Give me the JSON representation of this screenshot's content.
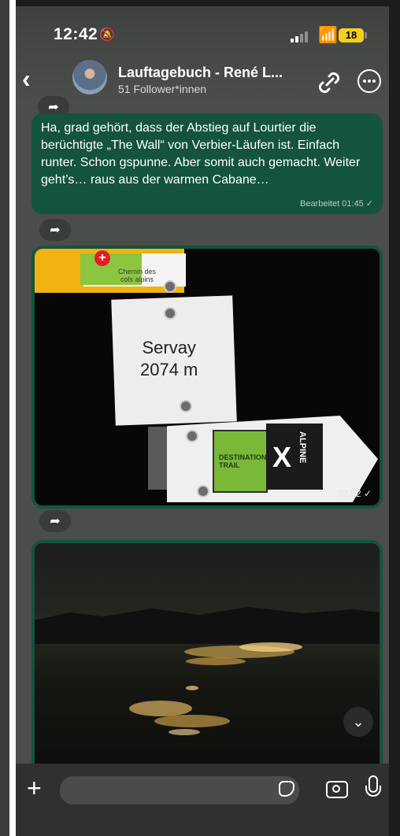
{
  "status_bar": {
    "time": "12:42",
    "battery": "18"
  },
  "header": {
    "title": "Lauftagebuch - René L...",
    "subtitle": "51 Follower*innen"
  },
  "messages": [
    {
      "text": "Ha, grad gehört, dass der Abstieg auf Lourtier die berüchtigte „The Wall“ von Verbier-Läufen ist. Einfach runter. Schon gspunne. Aber somit auch gemacht. Weiter geht’s… raus aus der warmen Cabane…",
      "meta": "Bearbeitet 01:45 ✓"
    }
  ],
  "photo1": {
    "timestamp": "02:52 ✓",
    "sign_top": "Chemin des cols alpins",
    "sign_line1": "Servay",
    "sign_line2": "2074 m",
    "logo_left": "DESTINATION TRAIL",
    "logo_right": "ALPINE"
  },
  "icons": {
    "back": "chevron-left-icon",
    "link": "link-icon",
    "menu": "ellipsis-icon",
    "forward": "share-icon",
    "scroll_down": "chevron-down-icon",
    "plus": "plus-icon",
    "sticker": "sticker-icon",
    "camera": "camera-icon",
    "mic": "mic-icon"
  },
  "colors": {
    "bubble": "#14533d",
    "background": "#4a4d4a",
    "battery": "#f2d21b"
  }
}
